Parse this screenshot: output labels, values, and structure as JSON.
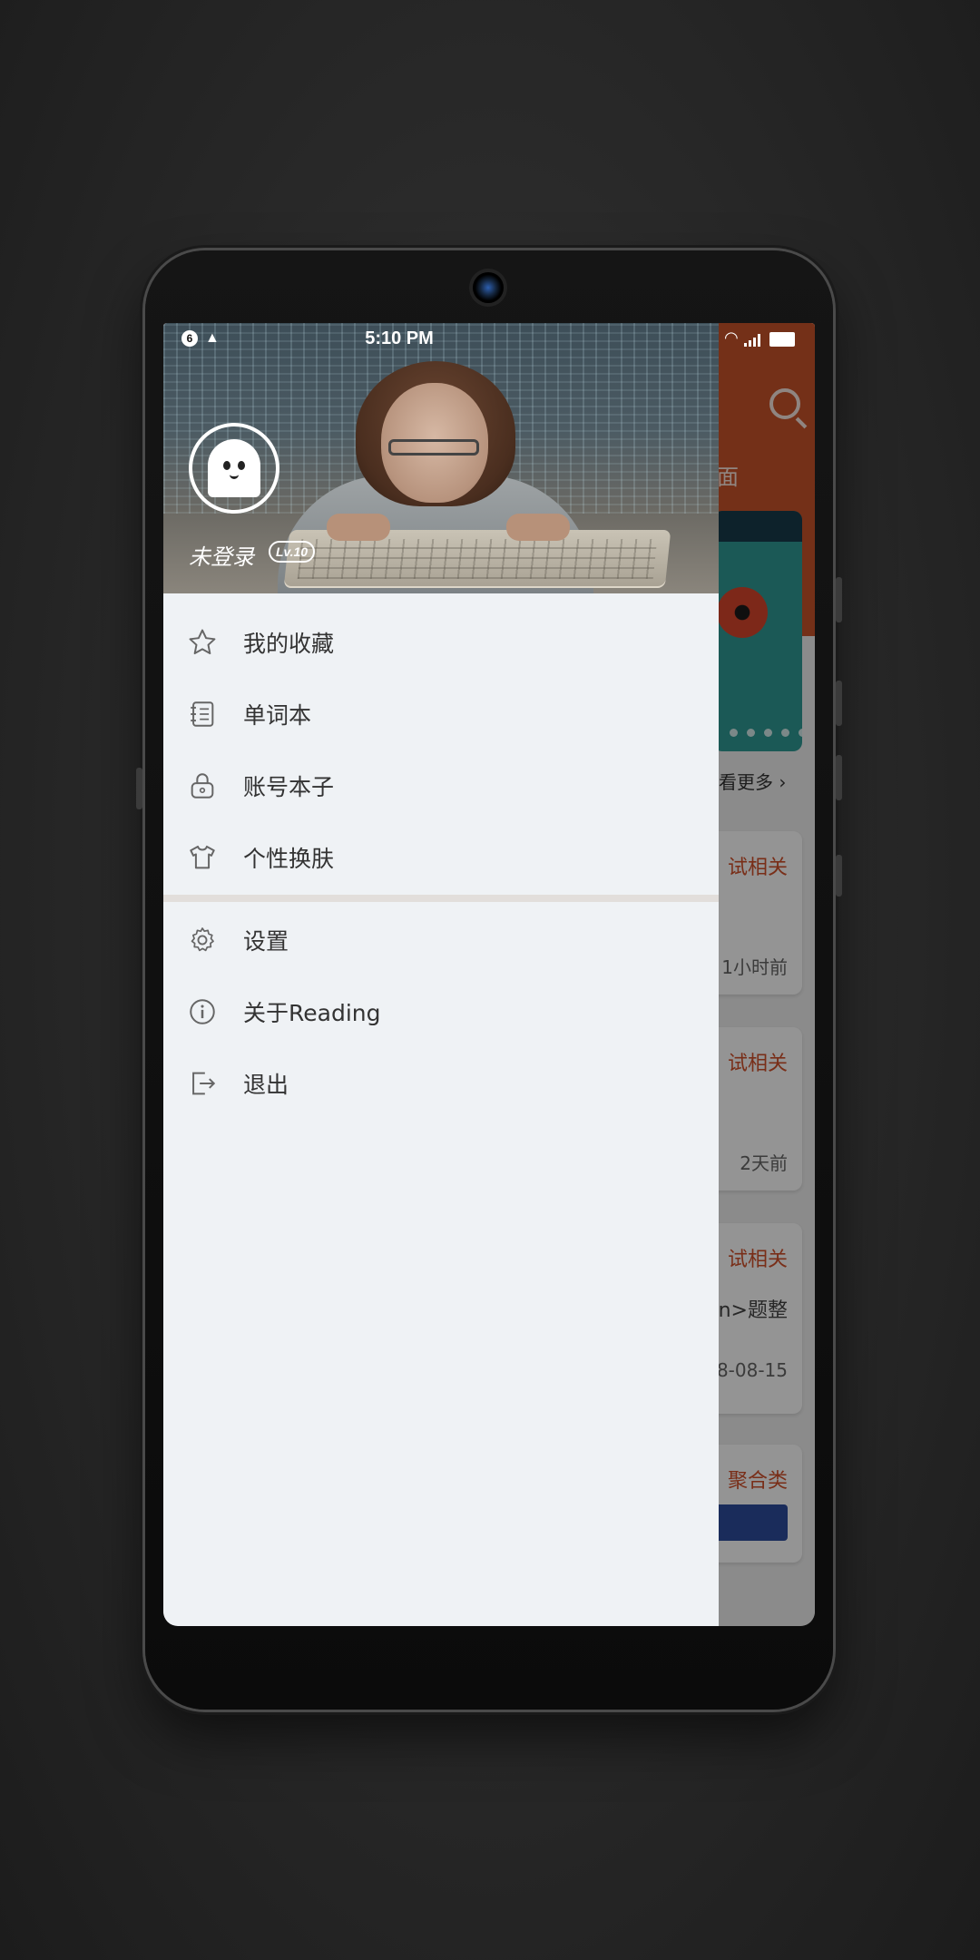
{
  "status_bar": {
    "notification_badge": "6",
    "time": "5:10 PM"
  },
  "background_app": {
    "tab_fragment": "面",
    "more_link": "看更多",
    "cards": [
      {
        "category": "试相关",
        "time": "1小时前"
      },
      {
        "category": "试相关",
        "time": "2天前"
      },
      {
        "category": "试相关",
        "text": "n>题整",
        "time": "8-08-15"
      },
      {
        "category": "聚合类"
      }
    ],
    "accent_color": "#c9542a"
  },
  "drawer": {
    "header": {
      "username": "未登录",
      "level": "Lv.10"
    },
    "menu_primary": [
      {
        "icon": "star-icon",
        "label": "我的收藏"
      },
      {
        "icon": "notebook-icon",
        "label": "单词本"
      },
      {
        "icon": "lock-icon",
        "label": "账号本子"
      },
      {
        "icon": "tshirt-icon",
        "label": "个性换肤"
      }
    ],
    "menu_secondary": [
      {
        "icon": "gear-icon",
        "label": "设置"
      },
      {
        "icon": "info-icon",
        "label": "关于Reading"
      },
      {
        "icon": "logout-icon",
        "label": "退出"
      }
    ]
  }
}
